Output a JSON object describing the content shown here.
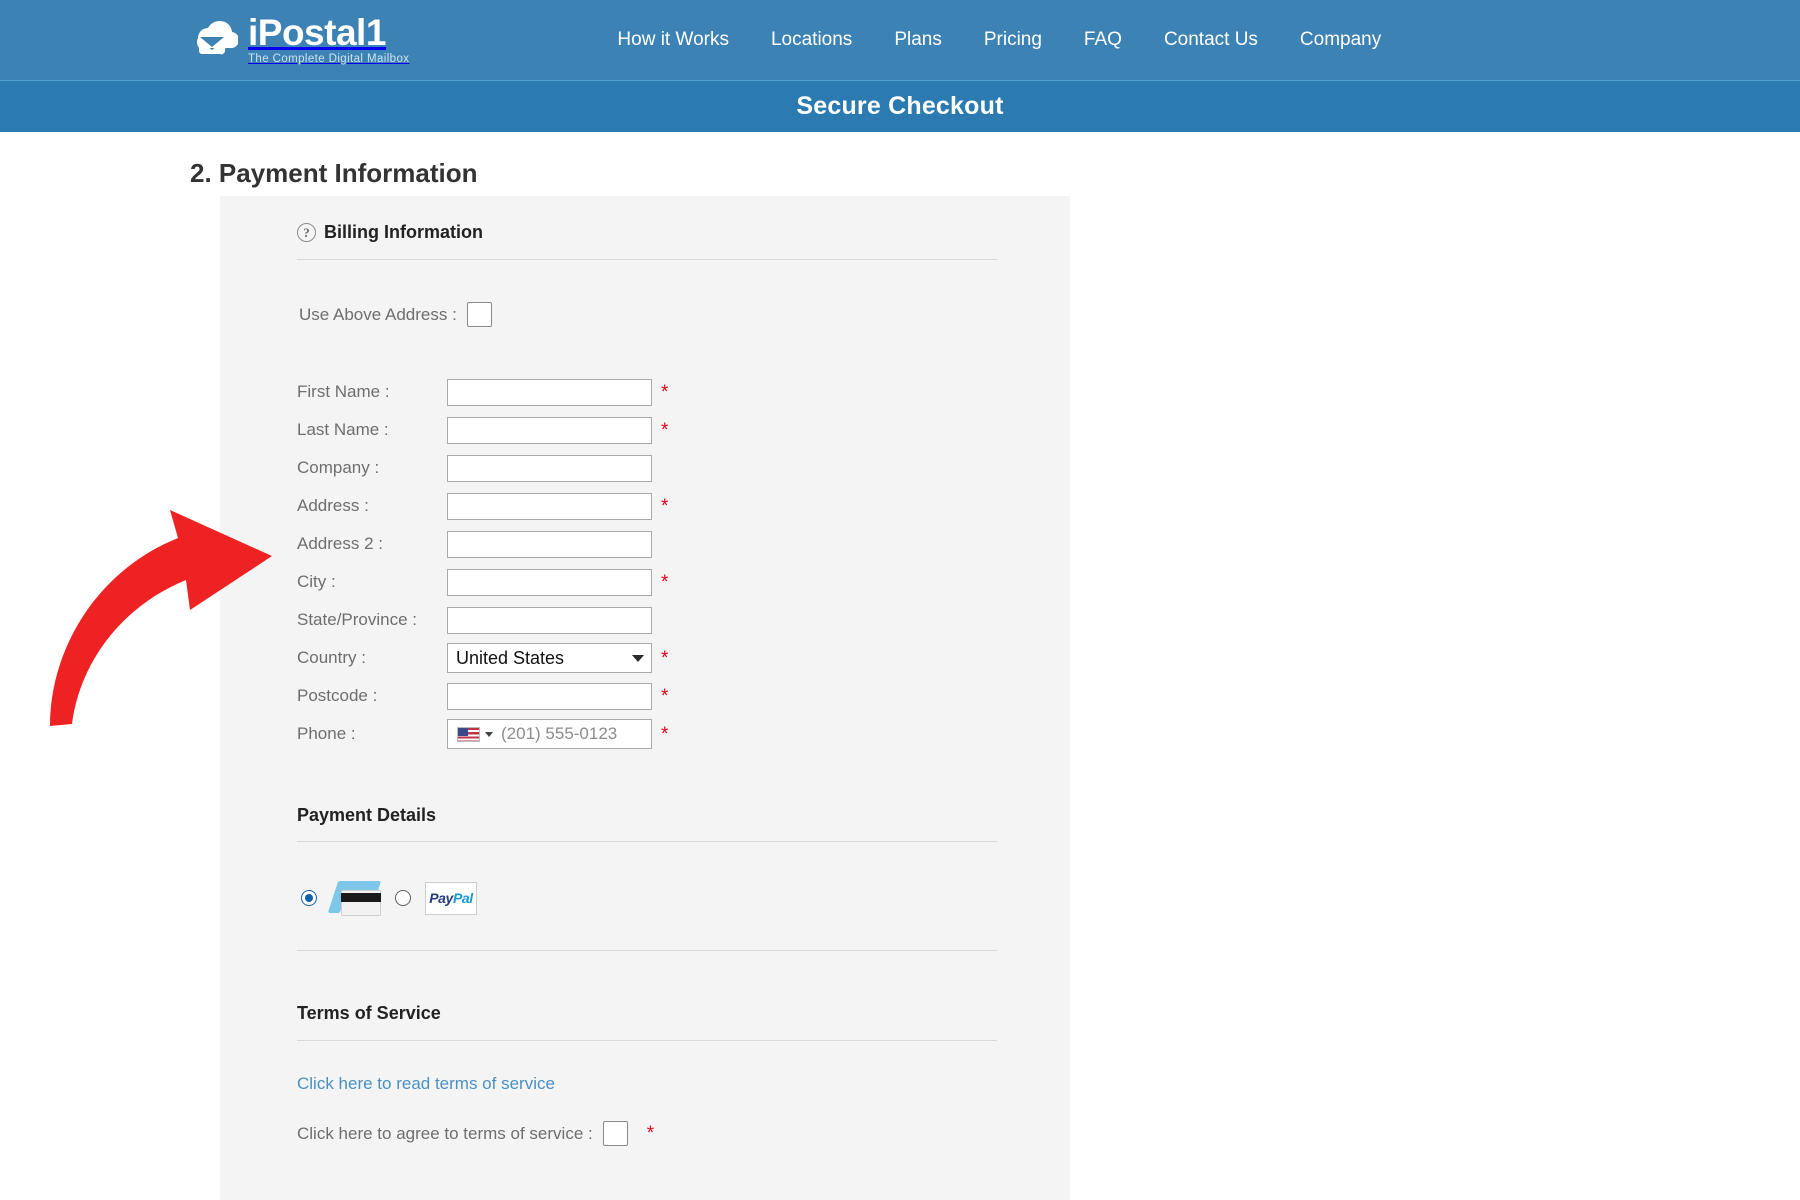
{
  "brand": {
    "name": "iPostal1",
    "tagline": "The Complete Digital Mailbox",
    "logo_icon": "cloud-mail-icon"
  },
  "nav": {
    "items": [
      {
        "label": "How it Works"
      },
      {
        "label": "Locations"
      },
      {
        "label": "Plans"
      },
      {
        "label": "Pricing"
      },
      {
        "label": "FAQ"
      },
      {
        "label": "Contact Us"
      },
      {
        "label": "Company"
      }
    ]
  },
  "banner": {
    "title": "Secure Checkout"
  },
  "page": {
    "section_heading": "2. Payment Information"
  },
  "billing": {
    "heading": "Billing Information",
    "help_icon": "question-mark-circle-icon",
    "use_above_address_label": "Use Above Address :",
    "use_above_address_checked": false,
    "fields": [
      {
        "label": "First Name :",
        "type": "text",
        "value": "",
        "required": true
      },
      {
        "label": "Last Name :",
        "type": "text",
        "value": "",
        "required": true
      },
      {
        "label": "Company :",
        "type": "text",
        "value": "",
        "required": false
      },
      {
        "label": "Address :",
        "type": "text",
        "value": "",
        "required": true
      },
      {
        "label": "Address 2 :",
        "type": "text",
        "value": "",
        "required": false
      },
      {
        "label": "City :",
        "type": "text",
        "value": "",
        "required": true
      },
      {
        "label": "State/Province :",
        "type": "text",
        "value": "",
        "required": false
      },
      {
        "label": "Country :",
        "type": "select",
        "value": "United States",
        "required": true
      },
      {
        "label": "Postcode :",
        "type": "text",
        "value": "",
        "required": true
      },
      {
        "label": "Phone :",
        "type": "phone",
        "value": "",
        "placeholder": "(201) 555-0123",
        "country_flag": "us-flag-icon",
        "required": true
      }
    ]
  },
  "payment": {
    "heading": "Payment Details",
    "methods": [
      {
        "name": "credit-card",
        "icon": "credit-card-icon",
        "selected": true
      },
      {
        "name": "paypal",
        "icon": "paypal-logo",
        "label_a": "Pay",
        "label_b": "Pal",
        "selected": false
      }
    ]
  },
  "terms": {
    "heading": "Terms of Service",
    "read_link": "Click here to read terms of service",
    "agree_label": "Click here to agree to terms of service :",
    "agree_checked": false,
    "agree_required": true
  },
  "annotation": {
    "type": "curved-arrow",
    "color": "#ee2222",
    "points_to": "billing-form-fields"
  },
  "colors": {
    "nav_blue": "#3d82b5",
    "banner_blue": "#2b7ab0",
    "panel_grey": "#f4f4f4",
    "required_red": "#e2001a",
    "link_blue": "#4a90c4",
    "arrow_red": "#ee2222"
  },
  "required_marker": "*"
}
